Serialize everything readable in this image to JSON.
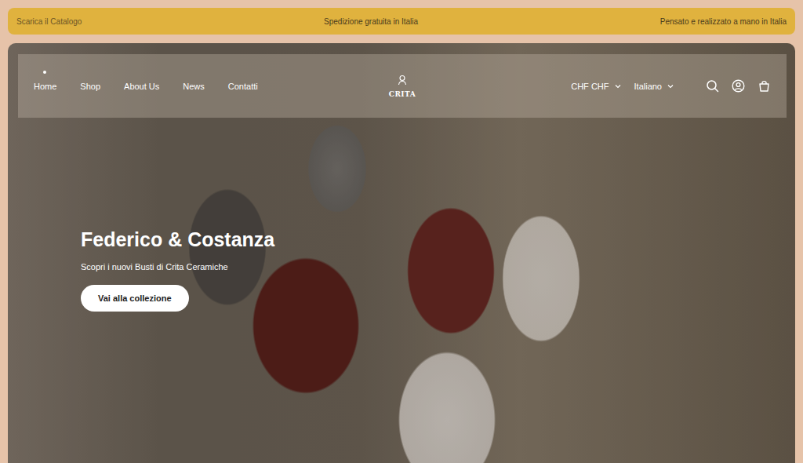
{
  "topbar": {
    "left": "Scarica il Catalogo",
    "center": "Spedizione gratuita in Italia",
    "right": "Pensato e realizzato a mano in Italia"
  },
  "nav": {
    "items": [
      {
        "label": "Home",
        "selected": true
      },
      {
        "label": "Shop",
        "selected": false
      },
      {
        "label": "About Us",
        "selected": false
      },
      {
        "label": "News",
        "selected": false
      },
      {
        "label": "Contatti",
        "selected": false
      }
    ],
    "logo": "CRITA",
    "currency": "CHF CHF",
    "language": "Italiano"
  },
  "hero": {
    "title": "Federico & Costanza",
    "subtitle": "Scopri i nuovi Busti di Crita Ceramiche",
    "button": "Vai alla collezione"
  }
}
